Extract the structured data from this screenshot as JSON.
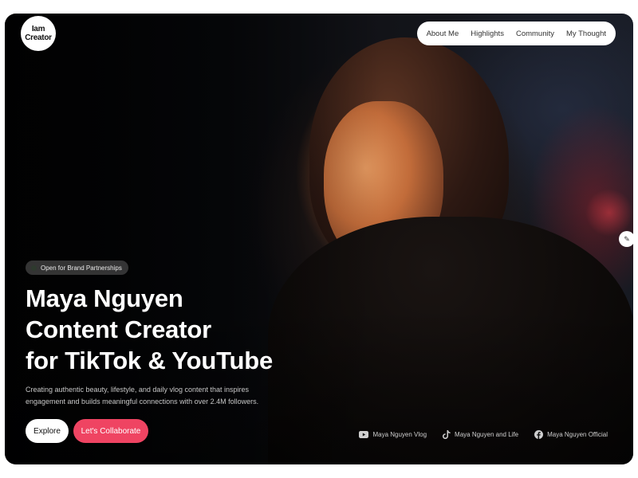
{
  "logo": {
    "line1": "Iam",
    "line2": "Creator"
  },
  "nav": {
    "items": [
      {
        "label": "About Me"
      },
      {
        "label": "Highlights"
      },
      {
        "label": "Community"
      },
      {
        "label": "My Thought"
      }
    ]
  },
  "edit_icon": "pencil-icon",
  "hero": {
    "badge": "Open for Brand Partnerships",
    "title_line1": "Maya Nguyen",
    "title_line2": "Content Creator",
    "title_line3": "for TikTok & YouTube",
    "description": "Creating authentic beauty, lifestyle, and daily vlog content that inspires engagement and builds meaningful connections with over 2.4M followers.",
    "explore_label": "Explore",
    "collab_label": "Let's Collaborate"
  },
  "socials": [
    {
      "icon": "youtube-icon",
      "label": "Maya Nguyen Vlog"
    },
    {
      "icon": "tiktok-icon",
      "label": "Maya Nguyen and Life"
    },
    {
      "icon": "facebook-icon",
      "label": "Maya Nguyen Official"
    }
  ],
  "colors": {
    "accent": "#ef4462",
    "background": "#0a0a0c",
    "nav_bg": "#ffffff"
  }
}
